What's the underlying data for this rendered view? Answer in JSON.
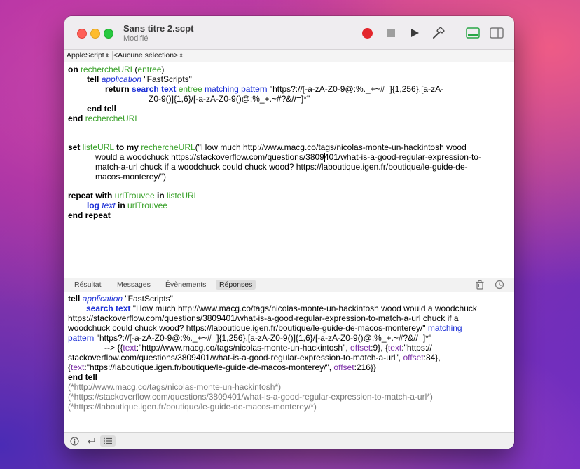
{
  "window": {
    "title": "Sans titre 2.scpt",
    "subtitle": "Modifié"
  },
  "navbar": {
    "language": "AppleScript",
    "selection": "<Aucune sélection>"
  },
  "editor": {
    "lines": [
      [
        "on",
        " ",
        "rechercheURL",
        "(",
        "entree",
        ")"
      ],
      []
    ],
    "l1": {
      "kw": "on",
      "handler": "rechercheURL",
      "open": "(",
      "param": "entree",
      "close": ")"
    },
    "l2": {
      "kw": "tell",
      "cls": "application",
      "str": "\"FastScripts\""
    },
    "l3": {
      "kw": "return",
      "cmd": "search text",
      "var": "entree",
      "label": "matching pattern",
      "str": "\"https?://[-a-zA-Z0-9@:%._+~#=]{1,256}.[a-zA-"
    },
    "l4": {
      "str": "Z0-9()]{1,6}/[-a-zA-Z0-9()@:%_+.~#?&//=]*\""
    },
    "l5": {
      "kw": "end tell"
    },
    "l6": {
      "kw": "end",
      "handler": "rechercheURL"
    },
    "l8": {
      "kw": "set",
      "var": "listeURL",
      "kw2": "to my",
      "handler": "rechercheURL",
      "str": "(\"How much http://www.macg.co/tags/nicolas-monte-un-hackintosh wood"
    },
    "l9": {
      "str": "would a woodchuck https://stackoverflow.com/questions/3809401/what-is-a-good-regular-expression-to-"
    },
    "l10": {
      "str": "match-a-url chuck if a woodchuck could chuck wood? https://laboutique.igen.fr/boutique/le-guide-de-"
    },
    "l11": {
      "str": "macos-monterey/\")"
    },
    "l13": {
      "kw": "repeat with",
      "var": "urlTrouvee",
      "kw2": "in",
      "var2": "listeURL"
    },
    "l14": {
      "cmd": "log",
      "cls": "text",
      "kw": "in",
      "var": "urlTrouvee"
    },
    "l15": {
      "kw": "end repeat"
    }
  },
  "tabs": {
    "result": "Résultat",
    "messages": "Messages",
    "events": "Évènements",
    "replies": "Réponses"
  },
  "results": {
    "r1": {
      "kw": "tell",
      "cls": "application",
      "str": "\"FastScripts\""
    },
    "r2": {
      "cmd": "search text",
      "str": "\"How much http://www.macg.co/tags/nicolas-monte-un-hackintosh wood would a woodchuck"
    },
    "r3": {
      "str": "https://stackoverflow.com/questions/3809401/what-is-a-good-regular-expression-to-match-a-url chuck if a"
    },
    "r4": {
      "str": "woodchuck could chuck wood? https://laboutique.igen.fr/boutique/le-guide-de-macos-monterey/\"",
      "label": "matching"
    },
    "r5": {
      "label": "pattern",
      "str": "\"https?://[-a-zA-Z0-9@:%._+~#=]{1,256}.[a-zA-Z0-9()]{1,6}/[-a-zA-Z0-9()@:%_+.~#?&//=]*\""
    },
    "r6": {
      "arrow": "--> {{",
      "k1": "text",
      "v1": ":\"http://www.macg.co/tags/nicolas-monte-un-hackintosh\", ",
      "k2": "offset",
      "v2": ":9}, {",
      "k3": "text",
      "v3": ":\"https://"
    },
    "r7": {
      "str": "stackoverflow.com/questions/3809401/what-is-a-good-regular-expression-to-match-a-url\", ",
      "k": "offset",
      "v": ":84},"
    },
    "r8": {
      "open": "{",
      "k1": "text",
      "v1": ":\"https://laboutique.igen.fr/boutique/le-guide-de-macos-monterey/\", ",
      "k2": "offset",
      "v2": ":216}}"
    },
    "r9": {
      "kw": "end tell"
    },
    "log1": "(*http://www.macg.co/tags/nicolas-monte-un-hackintosh*)",
    "log2": "(*https://stackoverflow.com/questions/3809401/what-is-a-good-regular-expression-to-match-a-url*)",
    "log3": "(*https://laboutique.igen.fr/boutique/le-guide-de-macos-monterey/*)"
  },
  "icons": {
    "record": "record-icon",
    "stop": "stop-icon",
    "play": "play-icon",
    "compile": "hammer-icon",
    "trash": "trash-icon",
    "history": "clock-icon",
    "info": "info-icon",
    "return": "return-arrow-icon",
    "list": "list-icon"
  },
  "colors": {
    "record": "#e3262c",
    "keyword_blue": "#1b2fd6",
    "variable_green": "#39a12a",
    "record_key_purple": "#7b2fa6"
  }
}
